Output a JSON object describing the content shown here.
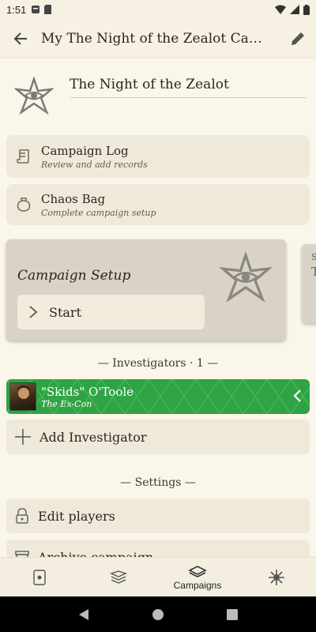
{
  "status": {
    "time": "1:51"
  },
  "appbar": {
    "title": "My The Night of the Zealot Campa…"
  },
  "campaign": {
    "name": "The Night of the Zealot"
  },
  "cards": [
    {
      "title": "Campaign Log",
      "subtitle": "Review and add records"
    },
    {
      "title": "Chaos Bag",
      "subtitle": "Complete campaign setup"
    }
  ],
  "setup": {
    "title": "Campaign Setup",
    "start_label": "Start",
    "peek_letters": [
      "S",
      "T"
    ]
  },
  "investigators": {
    "section_title": "— Investigators · 1 —",
    "items": [
      {
        "name": "\"Skids\" O'Toole",
        "subtitle": "The Ex-Con"
      }
    ],
    "add_label": "Add Investigator"
  },
  "settings": {
    "section_title": "— Settings —",
    "edit_players": "Edit players",
    "archive": "Archive campaign"
  },
  "bottom_nav": {
    "tabs": [
      {
        "icon": "card-icon",
        "label": ""
      },
      {
        "icon": "cards-stack-icon",
        "label": ""
      },
      {
        "icon": "campaigns-icon",
        "label": "Campaigns"
      },
      {
        "icon": "elder-sign-icon",
        "label": ""
      }
    ]
  },
  "colors": {
    "investigator_guardian_green": "#2fa444",
    "background": "#fbf6ea",
    "card": "#efe9da"
  }
}
